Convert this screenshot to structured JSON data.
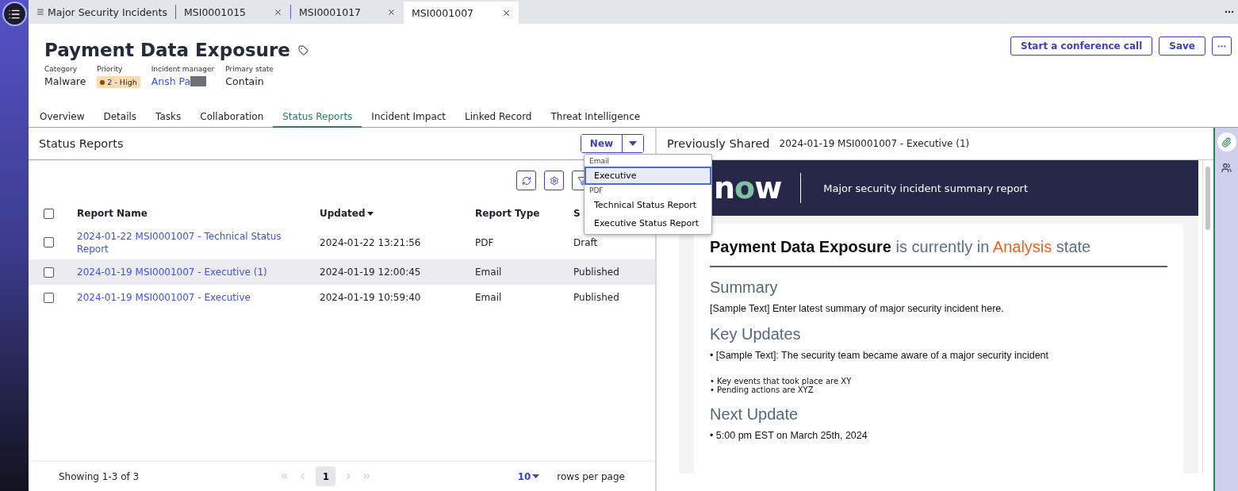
{
  "browser_tabs": [
    {
      "label": "Major Security Incidents",
      "kind": "list",
      "selected": false
    },
    {
      "label": "MSI0001015",
      "kind": "record",
      "selected": false
    },
    {
      "label": "MSI0001017",
      "kind": "record",
      "selected": false
    },
    {
      "label": "MSI0001007",
      "kind": "record",
      "selected": true
    }
  ],
  "record": {
    "title": "Payment Data Exposure",
    "fields": [
      {
        "label": "Category",
        "value": "Malware",
        "kind": "text"
      },
      {
        "label": "Priority",
        "value": "2 - High",
        "kind": "badge",
        "color": "#8a4b00"
      },
      {
        "label": "Incident manager",
        "value": "Ansh Pa",
        "kind": "link"
      },
      {
        "label": "Primary state",
        "value": "Contain",
        "kind": "text"
      }
    ],
    "actions": [
      "Start a conference call",
      "Save"
    ]
  },
  "record_tabs": [
    {
      "label": "Overview",
      "selected": false
    },
    {
      "label": "Details",
      "selected": false
    },
    {
      "label": "Tasks",
      "selected": false
    },
    {
      "label": "Collaboration",
      "selected": false
    },
    {
      "label": "Status Reports",
      "selected": true
    },
    {
      "label": "Incident Impact",
      "selected": false
    },
    {
      "label": "Linked Record",
      "selected": false
    },
    {
      "label": "Threat Intelligence",
      "selected": false
    }
  ],
  "status_reports": {
    "title": "Status Reports",
    "new_button": "New",
    "new_menu": [
      {
        "group": "Email",
        "items": [
          {
            "label": "Executive",
            "selected": true
          }
        ]
      },
      {
        "group": "PDF",
        "items": [
          {
            "label": "Technical Status Report",
            "selected": false
          },
          {
            "label": "Executive Status Report",
            "selected": false
          }
        ]
      }
    ],
    "table": {
      "all_checked": false,
      "columns": [
        {
          "label": "Report Name",
          "sorted": false
        },
        {
          "label": "Updated",
          "sorted": true
        },
        {
          "label": "Report Type",
          "sorted": false
        },
        {
          "label": "S",
          "sorted": false
        }
      ],
      "rows": [
        {
          "name": "2024-01-22 MSI0001007 - Technical Status Report",
          "updated": "2024-01-22 13:21:56",
          "type": "PDF",
          "status": "Draft",
          "checked": false,
          "selected": false
        },
        {
          "name": "2024-01-19 MSI0001007 - Executive (1)",
          "updated": "2024-01-19 12:00:45",
          "type": "Email",
          "status": "Published",
          "checked": false,
          "selected": true
        },
        {
          "name": "2024-01-19 MSI0001007 - Executive",
          "updated": "2024-01-19 10:59:40",
          "type": "Email",
          "status": "Published",
          "checked": false,
          "selected": false
        }
      ]
    },
    "footer": {
      "showing": "Showing 1-3 of 3",
      "page": "1",
      "rows_per_page": "10",
      "rows_label": "rows per page"
    }
  },
  "preview": {
    "title": "Previously Shared",
    "report": "2024-01-19 MSI0001007 - Executive (1)",
    "logo_text": "now",
    "banner": "Major security incident summary report",
    "headline": [
      {
        "text": "Payment Data Exposure",
        "kind": "bold"
      },
      {
        "text": " is currently in ",
        "kind": "plain"
      },
      {
        "text": "Analysis",
        "kind": "state"
      },
      {
        "text": " state",
        "kind": "plain"
      }
    ],
    "sections": [
      {
        "heading": "Summary",
        "lines": [
          {
            "text": "[Sample Text] Enter latest summary of major security incident here.",
            "kind": "body"
          }
        ]
      },
      {
        "heading": "Key Updates",
        "lines": [
          {
            "text": "• [Sample Text]: The security team became aware of a major security incident",
            "kind": "body"
          },
          {
            "text": "• Key events that took place are XY",
            "kind": "small"
          },
          {
            "text": "• Pending actions are XYZ",
            "kind": "small"
          }
        ]
      },
      {
        "heading": "Next Update",
        "lines": [
          {
            "text": "• 5:00 pm EST on March 25th, 2024",
            "kind": "body"
          }
        ]
      }
    ]
  }
}
